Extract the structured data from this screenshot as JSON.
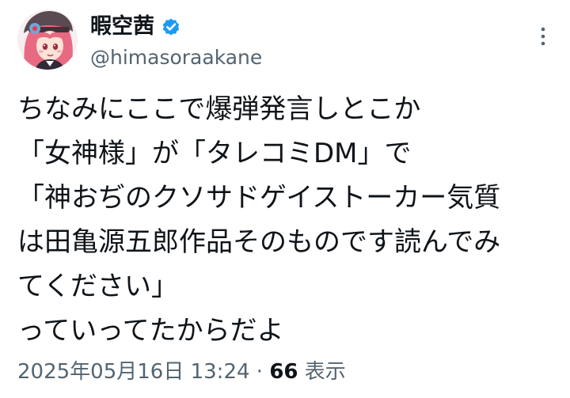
{
  "author": {
    "display_name": "暇空茜",
    "handle": "@himasoraakane",
    "verified_icon": "verified-badge-icon",
    "avatar_icon": "anime-avatar-icon"
  },
  "more_icon": "more-vertical-icon",
  "tweet": {
    "lines": [
      "ちなみにここで爆弾発言しとこか",
      "「女神様」が「タレコミDM」で",
      "「神おぢのクソサドゲイストーカー気質",
      "は田亀源五郎作品そのものです読んでみ",
      "てください」",
      "っていってたからだよ"
    ]
  },
  "meta": {
    "timestamp": "2025年05月16日 13:24",
    "separator": " · ",
    "views_count": "66",
    "views_label": " 表示"
  },
  "colors": {
    "text_primary": "#0f1419",
    "text_secondary": "#536471",
    "verified_blue": "#1d9bf0"
  }
}
